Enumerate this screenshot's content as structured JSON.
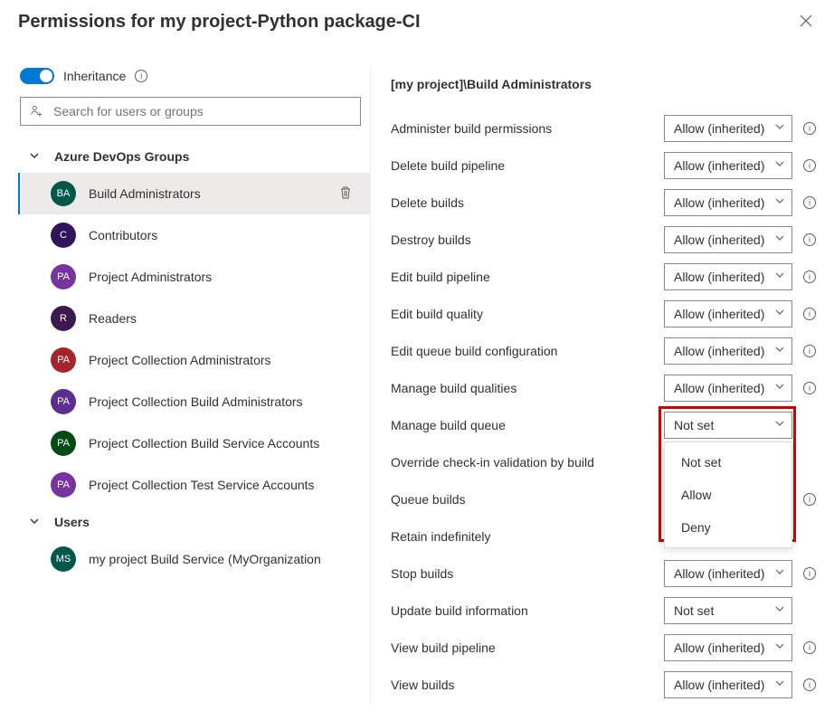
{
  "header": {
    "title": "Permissions for my project-Python package-CI"
  },
  "inheritance": {
    "label": "Inheritance"
  },
  "search": {
    "placeholder": "Search for users or groups"
  },
  "sections": {
    "groups_label": "Azure DevOps Groups",
    "users_label": "Users"
  },
  "groups": [
    {
      "initials": "BA",
      "name": "Build Administrators",
      "color": "#00574a",
      "selected": true
    },
    {
      "initials": "C",
      "name": "Contributors",
      "color": "#32145a"
    },
    {
      "initials": "PA",
      "name": "Project Administrators",
      "color": "#7734a0"
    },
    {
      "initials": "R",
      "name": "Readers",
      "color": "#3c1a4f"
    },
    {
      "initials": "PA",
      "name": "Project Collection Administrators",
      "color": "#a4262c"
    },
    {
      "initials": "PA",
      "name": "Project Collection Build Administrators",
      "color": "#5c2e91"
    },
    {
      "initials": "PA",
      "name": "Project Collection Build Service Accounts",
      "color": "#054b16"
    },
    {
      "initials": "PA",
      "name": "Project Collection Test Service Accounts",
      "color": "#7734a0"
    }
  ],
  "users": [
    {
      "initials": "MS",
      "name": "my project Build Service (MyOrganization",
      "color": "#00574a"
    }
  ],
  "detail": {
    "title": "[my project]\\Build Administrators",
    "permissions": [
      {
        "label": "Administer build permissions",
        "value": "Allow (inherited)",
        "info": true
      },
      {
        "label": "Delete build pipeline",
        "value": "Allow (inherited)",
        "info": true
      },
      {
        "label": "Delete builds",
        "value": "Allow (inherited)",
        "info": true
      },
      {
        "label": "Destroy builds",
        "value": "Allow (inherited)",
        "info": true
      },
      {
        "label": "Edit build pipeline",
        "value": "Allow (inherited)",
        "info": true
      },
      {
        "label": "Edit build quality",
        "value": "Allow (inherited)",
        "info": true
      },
      {
        "label": "Edit queue build configuration",
        "value": "Allow (inherited)",
        "info": true
      },
      {
        "label": "Manage build qualities",
        "value": "Allow (inherited)",
        "info": true
      },
      {
        "label": "Manage build queue",
        "value": "Not set",
        "info": false,
        "open": true
      },
      {
        "label": "Override check-in validation by build",
        "value": "",
        "info": false,
        "hidden": true
      },
      {
        "label": "Queue builds",
        "value": "",
        "info": true,
        "hidden": true
      },
      {
        "label": "Retain indefinitely",
        "value": "",
        "info": false,
        "hidden": true
      },
      {
        "label": "Stop builds",
        "value": "Allow (inherited)",
        "info": true
      },
      {
        "label": "Update build information",
        "value": "Not set",
        "info": false
      },
      {
        "label": "View build pipeline",
        "value": "Allow (inherited)",
        "info": true
      },
      {
        "label": "View builds",
        "value": "Allow (inherited)",
        "info": true
      }
    ],
    "options": [
      "Not set",
      "Allow",
      "Deny"
    ]
  }
}
